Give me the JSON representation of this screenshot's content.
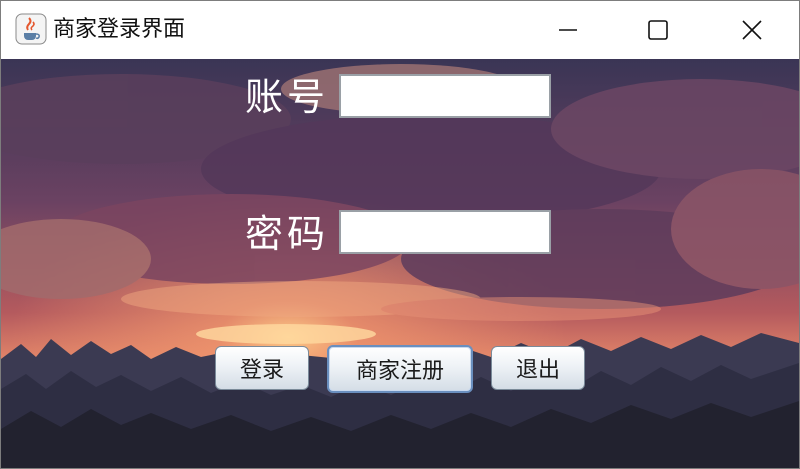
{
  "window": {
    "title": "商家登录界面",
    "app_icon": "java-coffee-icon"
  },
  "controls": {
    "minimize_icon": "minimize-icon",
    "maximize_icon": "maximize-icon",
    "close_icon": "close-icon"
  },
  "form": {
    "account_label": "账号",
    "account_value": "",
    "password_label": "密码",
    "password_value": ""
  },
  "buttons": {
    "login": "登录",
    "register": "商家注册",
    "exit": "退出"
  },
  "background": {
    "scene": "sunset-clouds-forest",
    "colors": [
      "#2b2540",
      "#6a3f5d",
      "#c9685a",
      "#f0a070",
      "#1f2433"
    ]
  }
}
